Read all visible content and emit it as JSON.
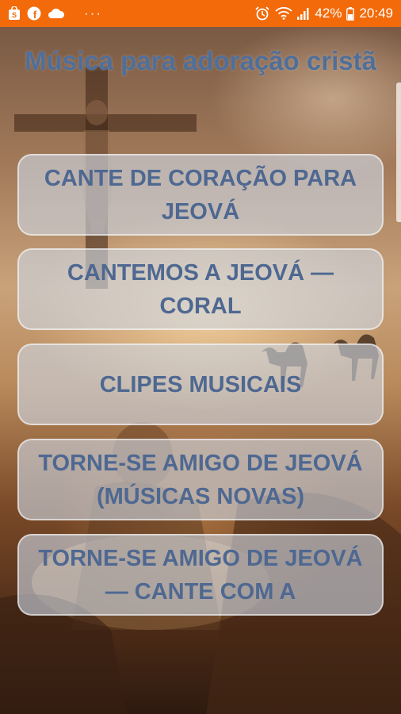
{
  "status_bar": {
    "battery": "42%",
    "time": "20:49",
    "overflow": "···",
    "icons_left": [
      "shopping-bag-icon",
      "facebook-icon",
      "cloud-icon"
    ],
    "icons_right": [
      "alarm-icon",
      "wifi-icon",
      "signal-icon",
      "battery-icon"
    ],
    "color": "#f26a0a"
  },
  "page": {
    "title": "Música para adoração cristã"
  },
  "buttons": [
    {
      "label": "CANTE DE CORAÇÃO PARA JEOVÁ"
    },
    {
      "label": "CANTEMOS A JEOVÁ — CORAL"
    },
    {
      "label": "CLIPES MUSICAIS"
    },
    {
      "label": "TORNE-SE AMIGO DE JEOVÁ (MÚSICAS NOVAS)"
    },
    {
      "label": "TORNE-SE AMIGO DE JEOVÁ — CANTE COM A"
    }
  ],
  "colors": {
    "title": "#4f6f9b",
    "button_text": "#4e6891",
    "button_bg": "rgba(205,214,228,0.62)"
  }
}
